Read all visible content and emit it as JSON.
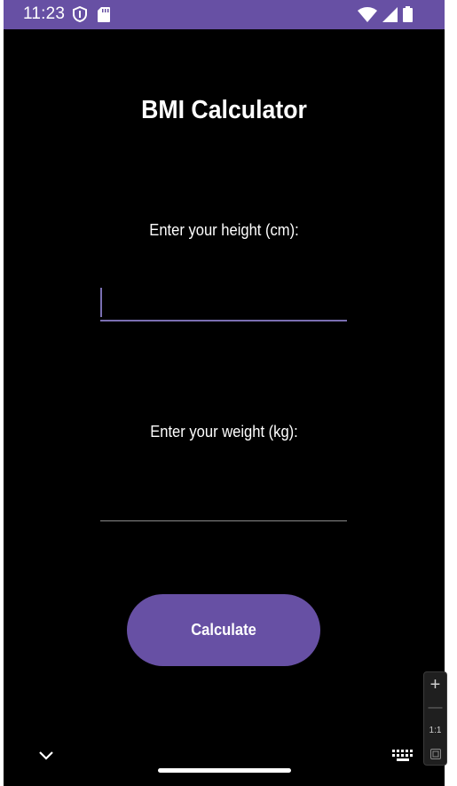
{
  "status_bar": {
    "time": "11:23",
    "left_icons": [
      "vpn-shield-icon",
      "sd-card-icon"
    ],
    "right_icons": [
      "wifi-icon",
      "cell-signal-icon",
      "battery-icon"
    ],
    "background": "#6750A4"
  },
  "app": {
    "title": "BMI Calculator",
    "height_label": "Enter your height (cm):",
    "height_value": "",
    "weight_label": "Enter your weight (kg):",
    "weight_value": "",
    "calculate_label": "Calculate",
    "accent_color": "#6750A4"
  },
  "nav_bar": {
    "icons": [
      "chevron-down-icon",
      "home-handle",
      "keyboard-icon"
    ]
  },
  "zoom_controls": {
    "zoom_in": "+",
    "zoom_out": "—",
    "reset_label": "1:1"
  }
}
